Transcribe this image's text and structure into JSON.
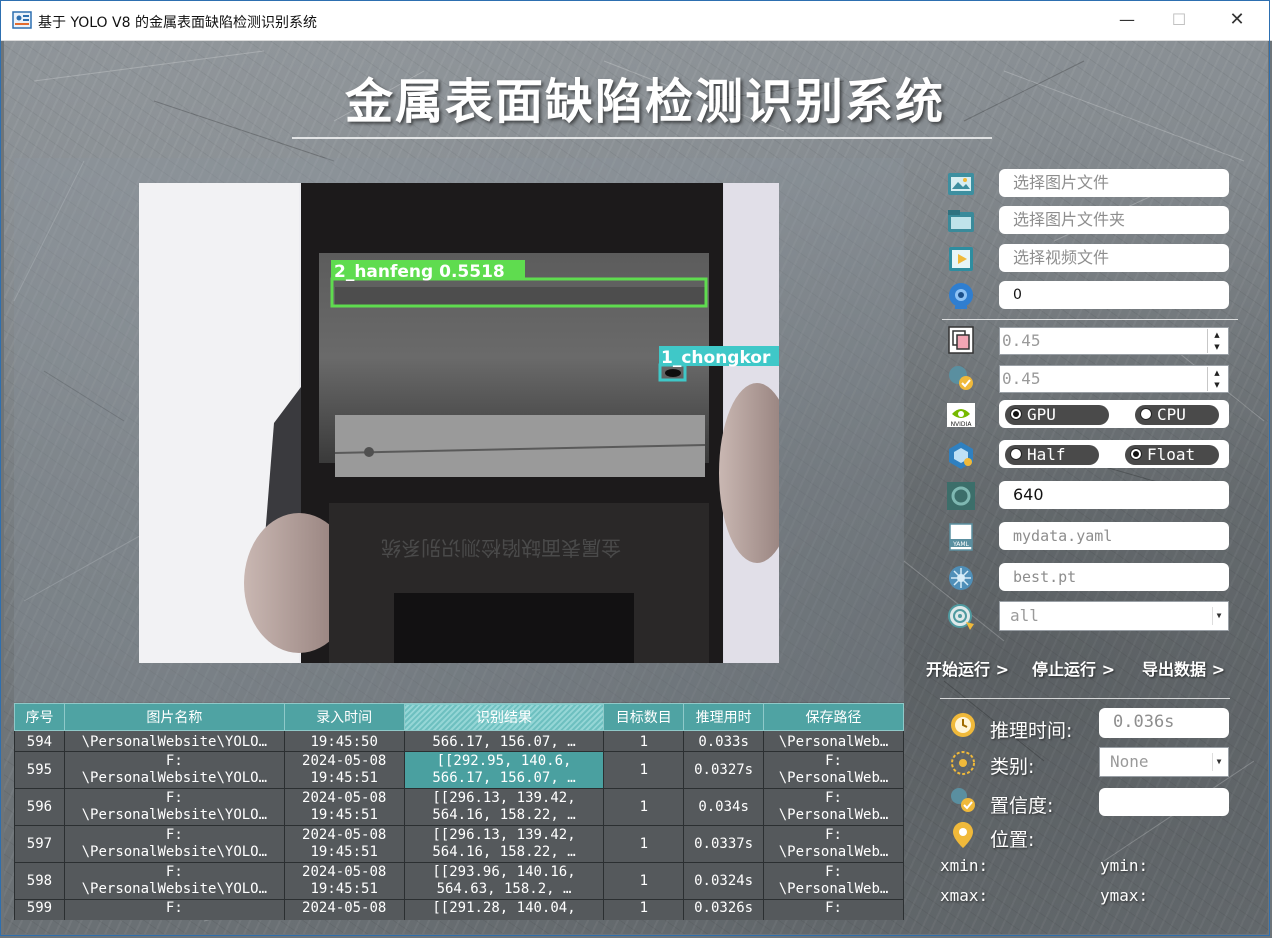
{
  "window": {
    "title": "基于 YOLO V8 的金属表面缺陷检测识别系统"
  },
  "header": {
    "title": "金属表面缺陷检测识别系统"
  },
  "detection_image": {
    "boxes": [
      {
        "label": "2_hanfeng 0.5518",
        "color": "#5fdc4f"
      },
      {
        "label": "1_chongkor",
        "color": "#3fc8c8"
      }
    ],
    "screen_text": "金属表面缺陷检测识别系统"
  },
  "controls": {
    "select_image_placeholder": "选择图片文件",
    "select_folder_placeholder": "选择图片文件夹",
    "select_video_placeholder": "选择视频文件",
    "camera_value": "0",
    "iou_value": "0.45",
    "conf_value": "0.45",
    "device_gpu": "GPU",
    "device_cpu": "CPU",
    "precision_half": "Half",
    "precision_float": "Float",
    "imgsz_value": "640",
    "data_yaml_placeholder": "mydata.yaml",
    "weights_placeholder": "best.pt",
    "class_filter": "all"
  },
  "actions": {
    "start": "开始运行 >",
    "stop": "停止运行 >",
    "export": "导出数据 >"
  },
  "info": {
    "infer_time_label": "推理时间:",
    "infer_time_value": "0.036s",
    "class_label": "类别:",
    "class_value": "None",
    "conf_label": "置信度:",
    "conf_value": "",
    "location_label": "位置:",
    "xmin_label": "xmin:",
    "ymin_label": "ymin:",
    "xmax_label": "xmax:",
    "ymax_label": "ymax:"
  },
  "table": {
    "columns": [
      "序号",
      "图片名称",
      "录入时间",
      "识别结果",
      "目标数目",
      "推理用时",
      "保存路径"
    ],
    "rows": [
      {
        "id": "594",
        "name": [
          "",
          "\\PersonalWebsite\\YOLO…"
        ],
        "time": [
          "",
          "19:45:50"
        ],
        "result": [
          "",
          "566.17, 156.07, …"
        ],
        "count": "1",
        "infer": "0.033s",
        "path": [
          "",
          "\\PersonalWeb…"
        ]
      },
      {
        "id": "595",
        "name": [
          "F:",
          "\\PersonalWebsite\\YOLO…"
        ],
        "time": [
          "2024-05-08",
          "19:45:51"
        ],
        "result": [
          "[[292.95, 140.6,",
          "566.17, 156.07, …"
        ],
        "count": "1",
        "infer": "0.0327s",
        "path": [
          "F:",
          "\\PersonalWeb…"
        ]
      },
      {
        "id": "596",
        "name": [
          "F:",
          "\\PersonalWebsite\\YOLO…"
        ],
        "time": [
          "2024-05-08",
          "19:45:51"
        ],
        "result": [
          "[[296.13, 139.42,",
          "564.16, 158.22, …"
        ],
        "count": "1",
        "infer": "0.034s",
        "path": [
          "F:",
          "\\PersonalWeb…"
        ]
      },
      {
        "id": "597",
        "name": [
          "F:",
          "\\PersonalWebsite\\YOLO…"
        ],
        "time": [
          "2024-05-08",
          "19:45:51"
        ],
        "result": [
          "[[296.13, 139.42,",
          "564.16, 158.22, …"
        ],
        "count": "1",
        "infer": "0.0337s",
        "path": [
          "F:",
          "\\PersonalWeb…"
        ]
      },
      {
        "id": "598",
        "name": [
          "F:",
          "\\PersonalWebsite\\YOLO…"
        ],
        "time": [
          "2024-05-08",
          "19:45:51"
        ],
        "result": [
          "[[293.96, 140.16,",
          "564.63, 158.2, …"
        ],
        "count": "1",
        "infer": "0.0324s",
        "path": [
          "F:",
          "\\PersonalWeb…"
        ]
      },
      {
        "id": "599",
        "name": [
          "F:",
          ""
        ],
        "time": [
          "2024-05-08",
          ""
        ],
        "result": [
          "[[291.28, 140.04,",
          ""
        ],
        "count": "1",
        "infer": "0.0326s",
        "path": [
          "F:",
          ""
        ]
      }
    ]
  }
}
